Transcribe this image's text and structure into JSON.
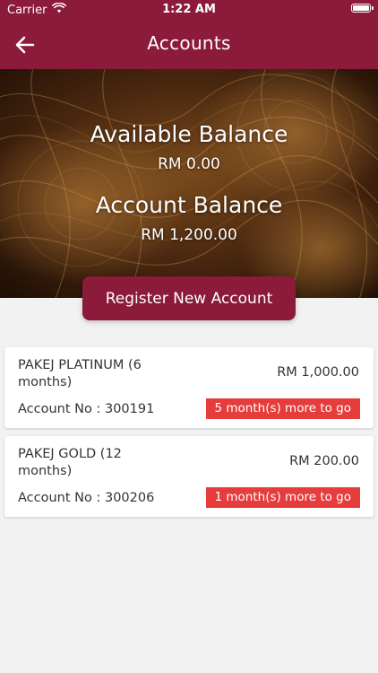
{
  "status_bar": {
    "carrier": "Carrier",
    "time": "1:22 AM"
  },
  "nav": {
    "title": "Accounts",
    "back_icon": "arrow-left-icon"
  },
  "summary": {
    "available_label": "Available Balance",
    "available_value": "RM 0.00",
    "account_label": "Account Balance",
    "account_value": "RM 1,200.00"
  },
  "register_button": "Register New Account",
  "accounts": [
    {
      "name": "PAKEJ PLATINUM (6 months)",
      "amount": "RM 1,000.00",
      "account_no": "Account No : 300191",
      "remaining": "5 month(s) more to go"
    },
    {
      "name": "PAKEJ GOLD (12 months)",
      "amount": "RM 200.00",
      "account_no": "Account No : 300206",
      "remaining": "1 month(s) more to go"
    }
  ],
  "colors": {
    "primary": "#8b1a3b",
    "badge": "#e63c3c",
    "background": "#f2f2f2",
    "card": "#ffffff"
  }
}
